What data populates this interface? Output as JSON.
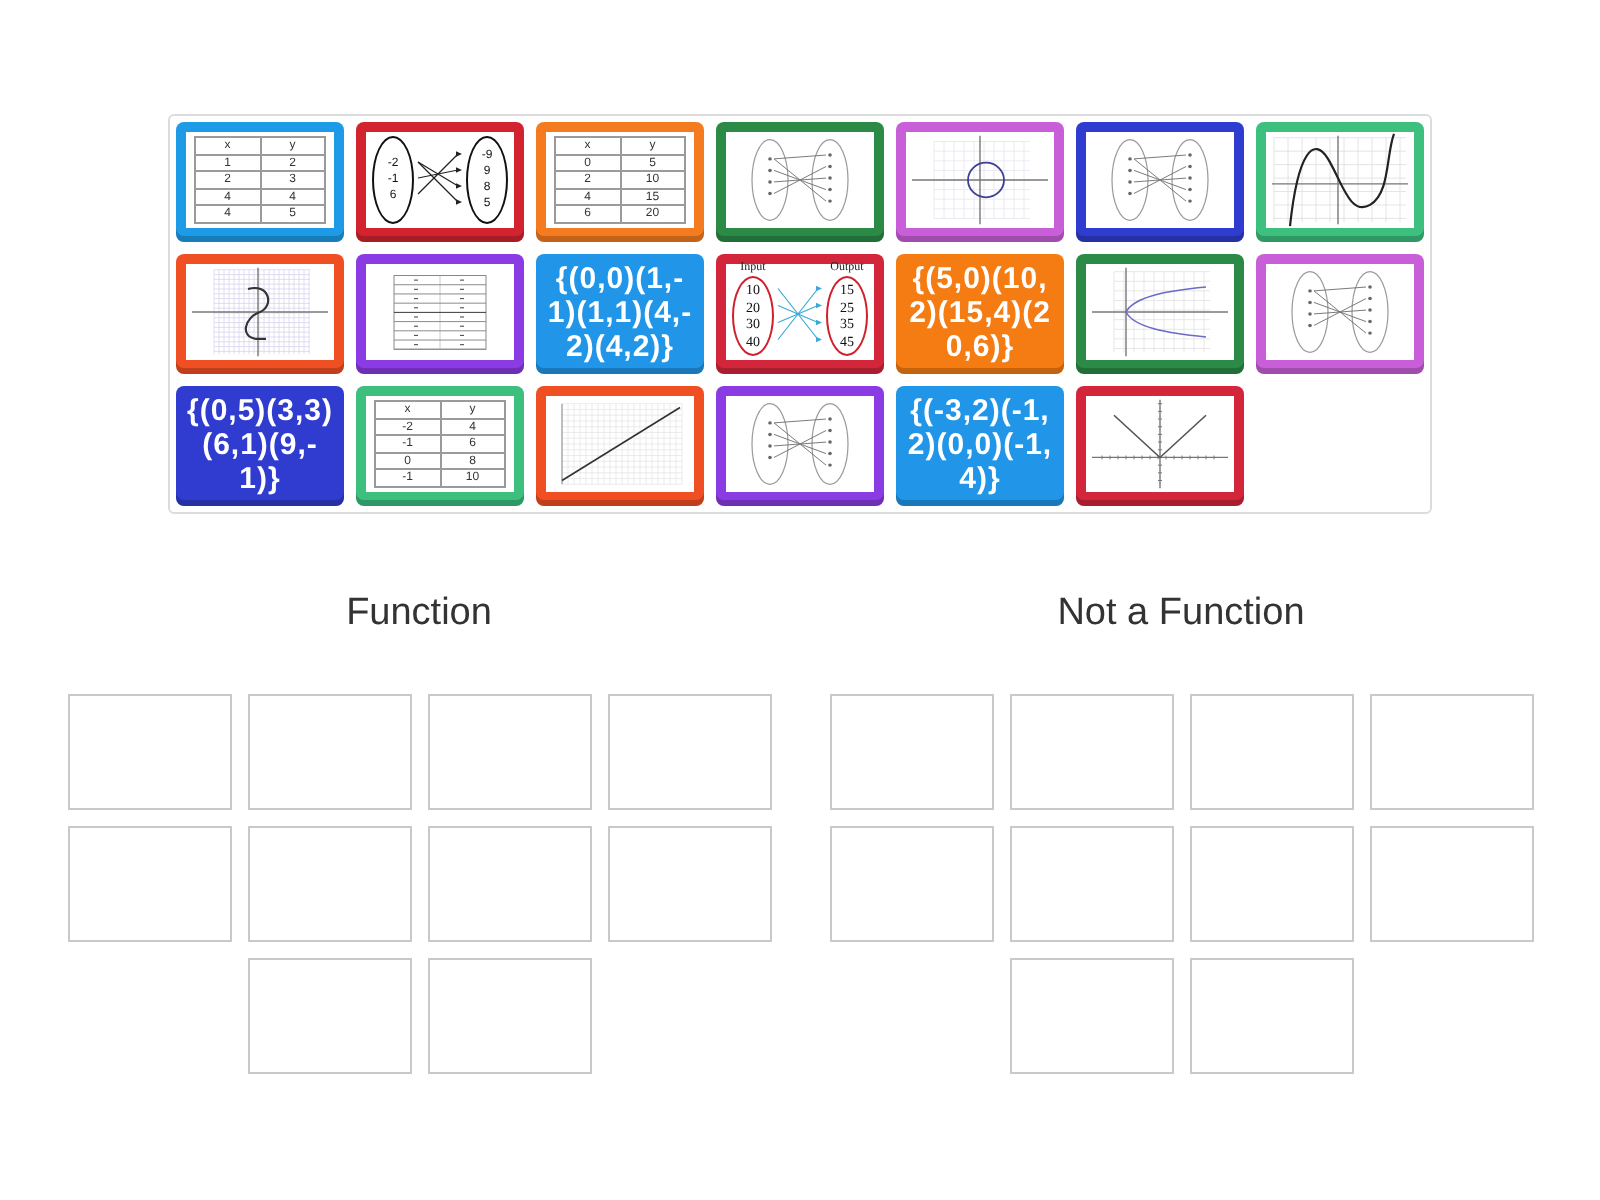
{
  "cards": [
    {
      "kind": "table",
      "color": "#1e9be6",
      "header": [
        "x",
        "y"
      ],
      "rows": [
        [
          "1",
          "2"
        ],
        [
          "2",
          "3"
        ],
        [
          "4",
          "4"
        ],
        [
          "4",
          "5"
        ]
      ]
    },
    {
      "kind": "mapping",
      "color": "#d2232f",
      "inputs": [
        "-2",
        "-1",
        "6"
      ],
      "outputs": [
        "-9",
        "9",
        "8",
        "5"
      ]
    },
    {
      "kind": "table",
      "color": "#f47b20",
      "header": [
        "x",
        "y"
      ],
      "rows": [
        [
          "0",
          "5"
        ],
        [
          "2",
          "10"
        ],
        [
          "4",
          "15"
        ],
        [
          "6",
          "20"
        ]
      ]
    },
    {
      "kind": "mapping-sketch",
      "color": "#2b8a46"
    },
    {
      "kind": "circle-graph",
      "color": "#c95fd8"
    },
    {
      "kind": "mapping-sketch",
      "color": "#2f3ccf"
    },
    {
      "kind": "cubic-graph",
      "color": "#3dbf7e"
    },
    {
      "kind": "s-curve-graph",
      "color": "#f04e23"
    },
    {
      "kind": "table-sketch",
      "color": "#8b3be3"
    },
    {
      "kind": "set",
      "color": "#2196e8",
      "text": "{(0,0)(1,-1)(1,1)(4,-2)(4,2)}"
    },
    {
      "kind": "io-mapping",
      "color": "#d4263a",
      "input_label": "Input",
      "output_label": "Output",
      "inputs": [
        "10",
        "20",
        "30",
        "40"
      ],
      "outputs": [
        "15",
        "25",
        "35",
        "45"
      ]
    },
    {
      "kind": "set",
      "color": "#f57c12",
      "text": "{(5,0)(10,2)(15,4)(20,6)}"
    },
    {
      "kind": "parabola-graph",
      "color": "#2b8a46"
    },
    {
      "kind": "mapping-sketch",
      "color": "#c95fd8"
    },
    {
      "kind": "set",
      "color": "#2f3ccf",
      "text": "{(0,5)(3,3)(6,1)(9,-1)}"
    },
    {
      "kind": "table",
      "color": "#3dbf7e",
      "header": [
        "x",
        "y"
      ],
      "rows": [
        [
          "-2",
          "4"
        ],
        [
          "-1",
          "6"
        ],
        [
          "0",
          "8"
        ],
        [
          "-1",
          "10"
        ]
      ]
    },
    {
      "kind": "line-graph",
      "color": "#f04e23"
    },
    {
      "kind": "mapping-sketch",
      "color": "#8b3be3"
    },
    {
      "kind": "set",
      "color": "#2196e8",
      "text": "{(-3,2)(-1,2)(0,0)(-1,4)}"
    },
    {
      "kind": "v-graph",
      "color": "#d4263a"
    }
  ],
  "groups": [
    {
      "title": "Function",
      "slots": [
        {
          "kind": "empty"
        },
        {
          "kind": "empty"
        },
        {
          "kind": "empty"
        },
        {
          "kind": "empty"
        },
        {
          "kind": "empty"
        },
        {
          "kind": "empty"
        },
        {
          "kind": "empty"
        },
        {
          "kind": "empty"
        },
        {
          "kind": "empty"
        },
        {
          "kind": "empty"
        }
      ]
    },
    {
      "title": "Not a Function",
      "slots": [
        {
          "kind": "empty"
        },
        {
          "kind": "empty"
        },
        {
          "kind": "empty"
        },
        {
          "kind": "empty"
        },
        {
          "kind": "empty"
        },
        {
          "kind": "empty"
        },
        {
          "kind": "empty"
        },
        {
          "kind": "empty"
        },
        {
          "kind": "empty"
        },
        {
          "kind": "empty"
        }
      ]
    }
  ]
}
